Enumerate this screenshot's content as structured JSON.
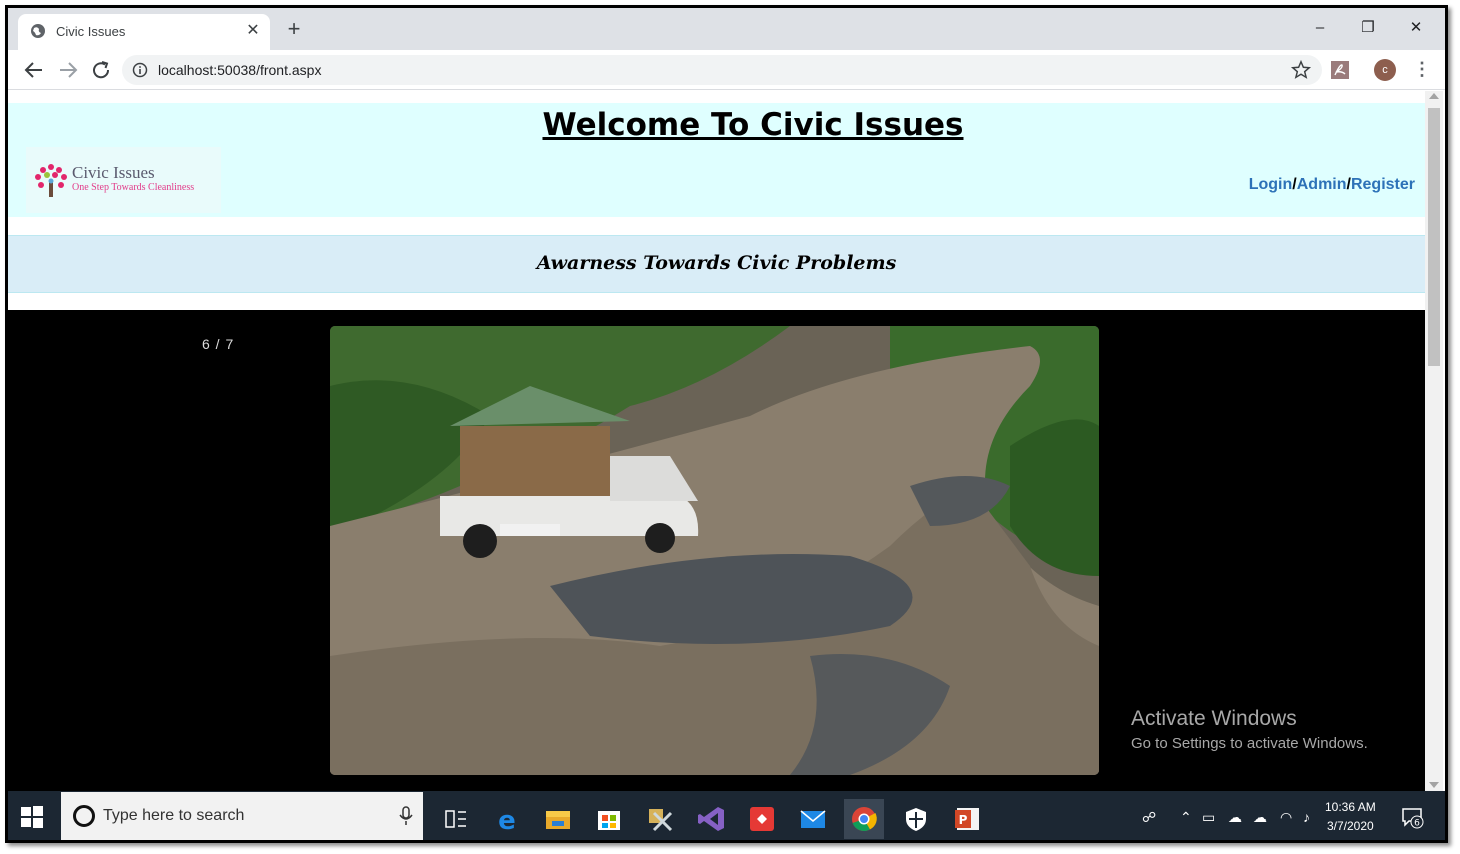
{
  "browser": {
    "tab_title": "Civic Issues",
    "tab_close": "✕",
    "new_tab": "+",
    "url": "localhost:50038/front.aspx",
    "avatar_letter": "c",
    "window_controls": {
      "minimize": "–",
      "restore": "❐",
      "close": "✕"
    }
  },
  "page": {
    "welcome_title": "Welcome To Civic Issues",
    "logo": {
      "title": "Civic Issues",
      "tagline": "One Step Towards Cleanliness"
    },
    "auth_links": {
      "login": "Login",
      "sep1": "/",
      "admin": "Admin",
      "sep2": "/",
      "register": "Register"
    },
    "banner": "Awarness Towards Civic Problems",
    "slideshow": {
      "counter": "6 / 7",
      "current": 6,
      "total": 7
    },
    "colors": {
      "header_bg": "#dfffff",
      "banner_bg": "#d9edf7",
      "link": "#2d72b8",
      "slideshow_bg": "#000000"
    }
  },
  "watermark": {
    "title": "Activate Windows",
    "subtitle": "Go to Settings to activate Windows."
  },
  "taskbar": {
    "search_placeholder": "Type here to search",
    "time": "10:36 AM",
    "date": "3/7/2020",
    "notification_count": "6",
    "apps": [
      "task-view-icon",
      "edge-icon",
      "file-explorer-icon",
      "store-icon",
      "tools-icon",
      "visual-studio-icon",
      "git-icon",
      "mail-icon",
      "chrome-icon",
      "security-icon",
      "powerpoint-icon"
    ]
  }
}
